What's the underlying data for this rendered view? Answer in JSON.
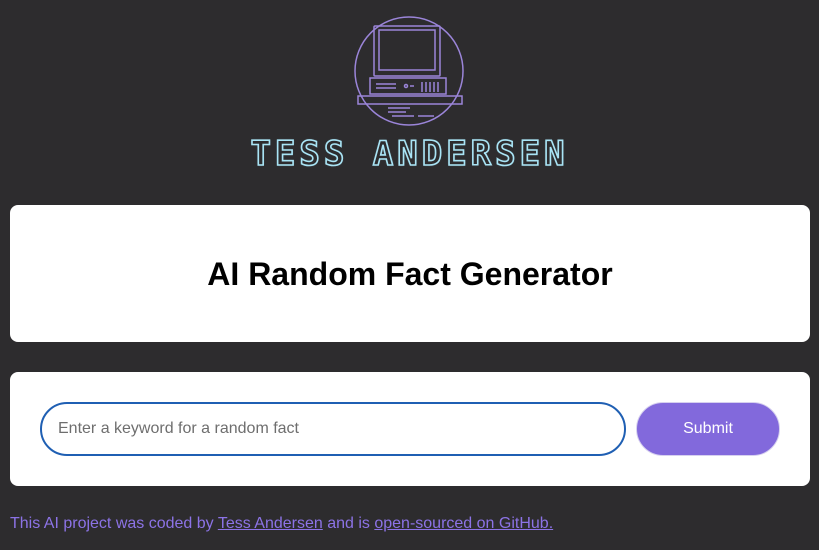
{
  "header": {
    "logo_icon": "retro-computer-icon",
    "logo_text": "TESS ANDERSEN"
  },
  "main": {
    "title": "AI Random Fact Generator"
  },
  "form": {
    "input_placeholder": "Enter a keyword for a random fact",
    "input_value": "",
    "submit_label": "Submit"
  },
  "footer": {
    "text_before": "This AI project was coded by ",
    "author_link": "Tess Andersen",
    "text_middle": " and is ",
    "github_link": "open-sourced on GitHub."
  },
  "colors": {
    "background": "#2d2c2e",
    "logo_text": "#a9e4f5",
    "logo_icon": "#9b85d9",
    "accent": "#8269dc",
    "input_border": "#1f5fb3",
    "footer_link": "#8c73e6"
  }
}
